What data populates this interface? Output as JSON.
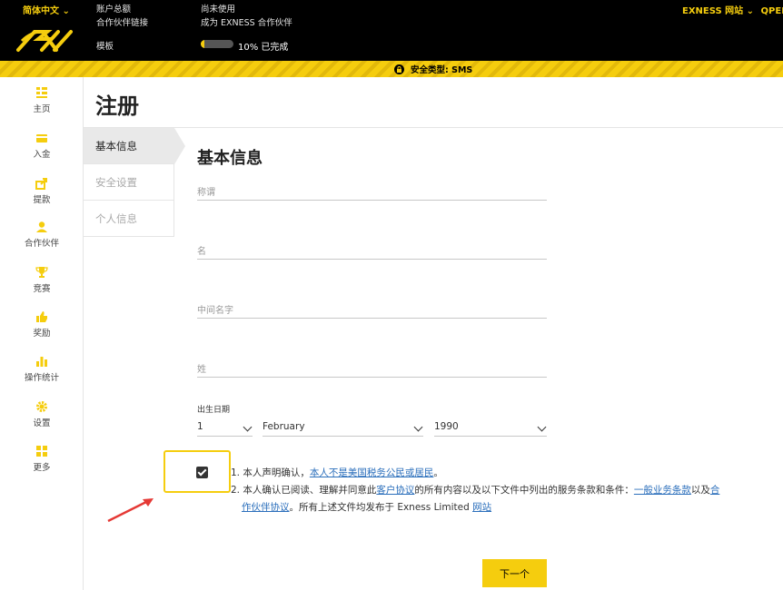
{
  "header": {
    "language": "简体中文",
    "account_total_label": "账户总额",
    "partner_link_label": "合作伙伴链接",
    "template_label": "模板",
    "not_used_label": "尚未使用",
    "become_partner": "成为 EXNESS 合作伙伴",
    "progress_text": "10% 已完成",
    "progress_value": 0.1,
    "site_link": "EXNESS 网站",
    "open_label": "QPEN"
  },
  "security_bar": {
    "text": "安全类型: SMS"
  },
  "sidebar": {
    "items": [
      {
        "label": "主页",
        "icon": "grid-icon"
      },
      {
        "label": "入金",
        "icon": "wallet-icon"
      },
      {
        "label": "提款",
        "icon": "withdraw-icon"
      },
      {
        "label": "合作伙伴",
        "icon": "user-icon"
      },
      {
        "label": "竞赛",
        "icon": "trophy-icon"
      },
      {
        "label": "奖励",
        "icon": "thumbs-up-icon"
      },
      {
        "label": "操作统计",
        "icon": "bar-chart-icon"
      },
      {
        "label": "设置",
        "icon": "gear-icon"
      },
      {
        "label": "更多",
        "icon": "tiles-icon"
      }
    ]
  },
  "page": {
    "title": "注册",
    "steps": [
      "基本信息",
      "安全设置",
      "个人信息"
    ],
    "section_title": "基本信息"
  },
  "form": {
    "salutation_placeholder": "称谓",
    "first_name_placeholder": "名",
    "middle_name_placeholder": "中间名字",
    "last_name_placeholder": "姓",
    "dob_label": "出生日期",
    "dob_day": "1",
    "dob_month": "February",
    "dob_year": "1990"
  },
  "agreement": {
    "line1_prefix": "1. 本人声明确认，",
    "line1_link": "本人不是美国税务公民或居民",
    "line1_suffix": "。",
    "line2_prefix": "2. 本人确认已阅读、理解并同意此",
    "line2_link1": "客户协议",
    "line2_mid": "的所有内容以及以下文件中列出的服务条款和条件：",
    "line2_link2": "一般业务条款",
    "line2_and": "以及",
    "line2_link3a": "合",
    "line3_link3b": "作伙伴协议",
    "line3_mid": "。所有上述文件均发布于 Exness Limited ",
    "line3_link4": "网站"
  },
  "next_button": "下一个",
  "colors": {
    "accent": "#f5cd0e",
    "link": "#2a6ebb",
    "annotation_arrow": "#e53935"
  }
}
